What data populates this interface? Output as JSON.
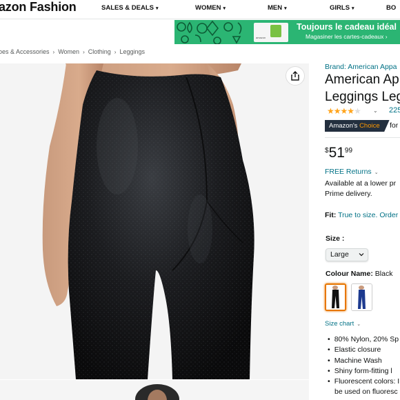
{
  "nav": {
    "brand": "azon Fashion",
    "links": [
      {
        "label": "SALES & DEALS"
      },
      {
        "label": "WOMEN"
      },
      {
        "label": "MEN"
      },
      {
        "label": "GIRLS"
      },
      {
        "label": "BO"
      }
    ]
  },
  "promo": {
    "title": "Toujours le cadeau idéal",
    "subtitle": "Magasiner les cartes-cadeaux ›",
    "card_label": "amazon"
  },
  "breadcrumb": [
    "oes & Accessories",
    "Women",
    "Clothing",
    "Leggings"
  ],
  "product": {
    "brand_link": "Brand: American Appa",
    "title_lines": [
      "American App",
      "Leggings Leg"
    ],
    "rating": 4,
    "rating_count": "225",
    "badge_prefix": "Amazon's",
    "badge_choice": "Choice",
    "badge_for": "for",
    "price": {
      "currency": "$",
      "whole": "51",
      "fraction": "99"
    },
    "free_returns": "FREE Returns",
    "availability_lines": [
      "Available at a lower pr",
      "Prime delivery."
    ],
    "fit_label": "Fit:",
    "fit_value": "True to size. Order",
    "size_label": "Size :",
    "size_value": "Large",
    "colour_label": "Colour Name:",
    "colour_value": "Black",
    "size_chart": "Size chart",
    "bullets": [
      "80% Nylon, 20% Sp",
      "Elastic closure",
      "Machine Wash",
      "Shiny form-fitting l",
      "Fluorescent colors: I"
    ],
    "bullet_continuation": "be used on fluoresc"
  },
  "colors": {
    "link": "#007185",
    "promo_bg": "#2bb573",
    "badge_bg": "#232f3e",
    "badge_accent": "#ff9900",
    "star": "#ffa41c",
    "swatch_selected": "#e77600"
  },
  "icons": {
    "share": "share-icon",
    "caret": "chevron-down-icon"
  }
}
